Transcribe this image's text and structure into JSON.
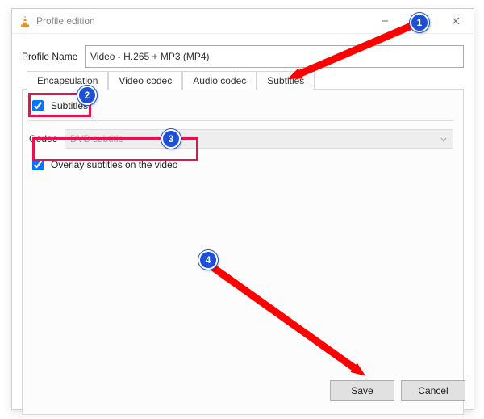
{
  "window": {
    "title": "Profile edition"
  },
  "profile": {
    "label": "Profile Name",
    "value": "Video - H.265 + MP3 (MP4)"
  },
  "tabs": {
    "encapsulation": "Encapsulation",
    "video": "Video codec",
    "audio": "Audio codec",
    "subtitles": "Subtitles"
  },
  "subs": {
    "enable": "Subtitles",
    "codec_label": "Codec",
    "codec_value": "DVB subtitle",
    "overlay": "Overlay subtitles on the video"
  },
  "buttons": {
    "save": "Save",
    "cancel": "Cancel"
  },
  "badges": {
    "b1": "1",
    "b2": "2",
    "b3": "3",
    "b4": "4"
  }
}
